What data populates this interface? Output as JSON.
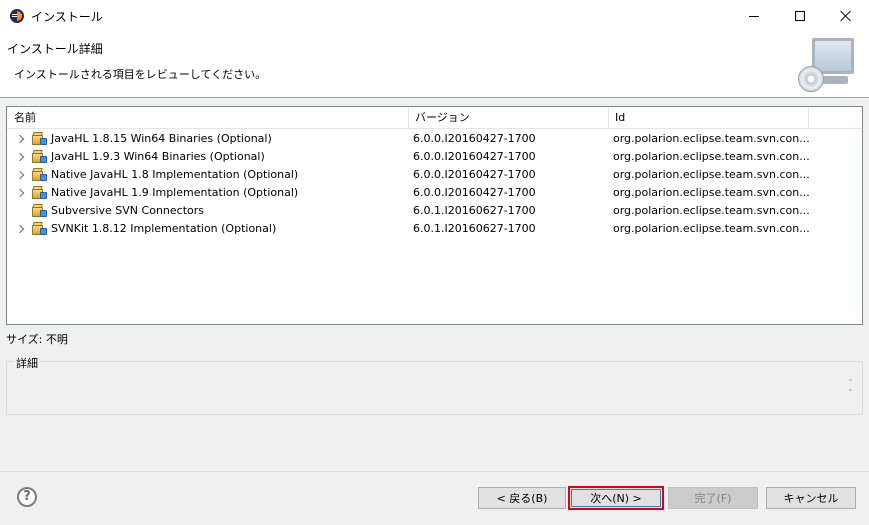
{
  "window": {
    "title": "インストール"
  },
  "header": {
    "title": "インストール詳細",
    "description": "インストールされる項目をレビューしてください。"
  },
  "table": {
    "columns": [
      "名前",
      "バージョン",
      "Id"
    ],
    "rows": [
      {
        "name": "JavaHL 1.8.15 Win64 Binaries (Optional)",
        "version": "6.0.0.I20160427-1700",
        "id": "org.polarion.eclipse.team.svn.con...",
        "expandable": true
      },
      {
        "name": "JavaHL 1.9.3 Win64 Binaries (Optional)",
        "version": "6.0.0.I20160427-1700",
        "id": "org.polarion.eclipse.team.svn.con...",
        "expandable": true
      },
      {
        "name": "Native JavaHL 1.8 Implementation (Optional)",
        "version": "6.0.0.I20160427-1700",
        "id": "org.polarion.eclipse.team.svn.con...",
        "expandable": true
      },
      {
        "name": "Native JavaHL 1.9 Implementation (Optional)",
        "version": "6.0.0.I20160427-1700",
        "id": "org.polarion.eclipse.team.svn.con...",
        "expandable": true
      },
      {
        "name": "Subversive SVN Connectors",
        "version": "6.0.1.I20160627-1700",
        "id": "org.polarion.eclipse.team.svn.con...",
        "expandable": false
      },
      {
        "name": "SVNKit 1.8.12 Implementation (Optional)",
        "version": "6.0.1.I20160627-1700",
        "id": "org.polarion.eclipse.team.svn.con...",
        "expandable": true
      }
    ]
  },
  "size_label": "サイズ: 不明",
  "details": {
    "legend": "詳細"
  },
  "buttons": {
    "help": "?",
    "back": "< 戻る(B)",
    "next": "次へ(N) >",
    "finish": "完了(F)",
    "cancel": "キャンセル"
  }
}
